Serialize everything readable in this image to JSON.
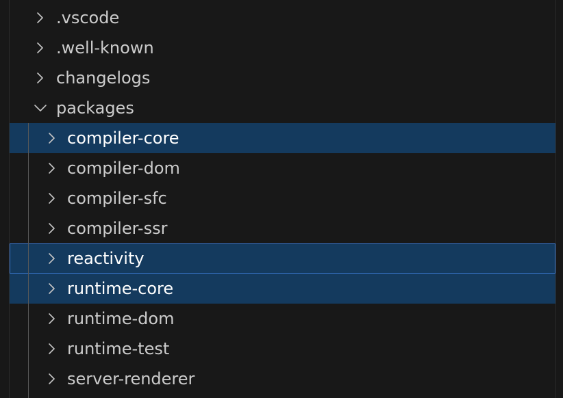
{
  "explorer": {
    "items": [
      {
        "label": ".vscode",
        "expanded": false,
        "level": 0,
        "state": "none"
      },
      {
        "label": ".well-known",
        "expanded": false,
        "level": 0,
        "state": "none"
      },
      {
        "label": "changelogs",
        "expanded": false,
        "level": 0,
        "state": "none"
      },
      {
        "label": "packages",
        "expanded": true,
        "level": 0,
        "state": "none"
      },
      {
        "label": "compiler-core",
        "expanded": false,
        "level": 1,
        "state": "selected"
      },
      {
        "label": "compiler-dom",
        "expanded": false,
        "level": 1,
        "state": "none"
      },
      {
        "label": "compiler-sfc",
        "expanded": false,
        "level": 1,
        "state": "none"
      },
      {
        "label": "compiler-ssr",
        "expanded": false,
        "level": 1,
        "state": "none"
      },
      {
        "label": "reactivity",
        "expanded": false,
        "level": 1,
        "state": "focused"
      },
      {
        "label": "runtime-core",
        "expanded": false,
        "level": 1,
        "state": "selected"
      },
      {
        "label": "runtime-dom",
        "expanded": false,
        "level": 1,
        "state": "none"
      },
      {
        "label": "runtime-test",
        "expanded": false,
        "level": 1,
        "state": "none"
      },
      {
        "label": "server-renderer",
        "expanded": false,
        "level": 1,
        "state": "none"
      }
    ],
    "icons": {
      "collapsed": "chevron-right-icon",
      "expanded": "chevron-down-icon"
    },
    "colors": {
      "background": "#181818",
      "selection": "#143a5e",
      "focus_border": "#3b7ad4",
      "text": "#cccccc",
      "text_selected": "#ffffff",
      "indent_guide": "#585858"
    }
  }
}
